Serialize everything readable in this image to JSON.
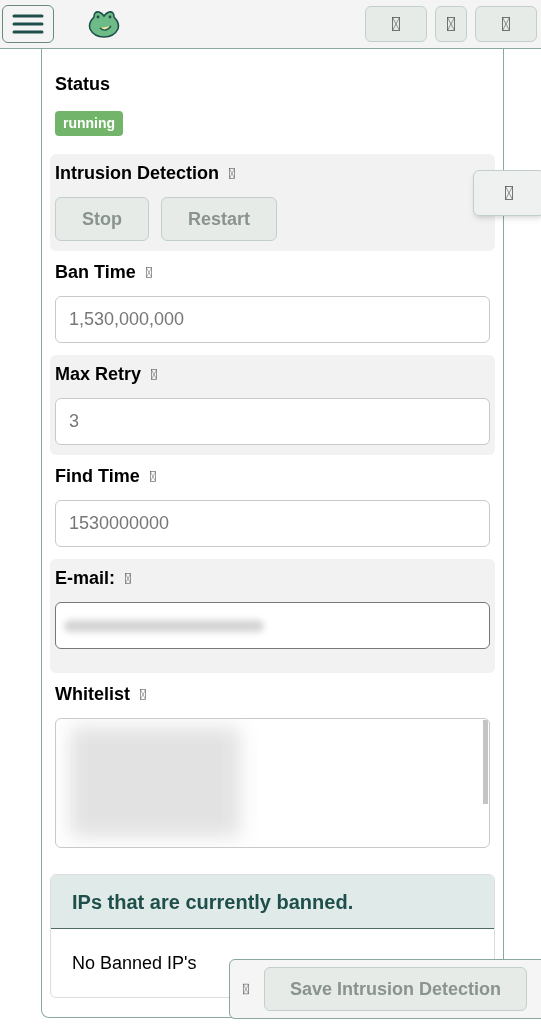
{
  "header": {
    "toolbar_buttons": [
      {
        "kind": "wide"
      },
      {
        "kind": "narrow"
      },
      {
        "kind": "wide"
      }
    ]
  },
  "status": {
    "label": "Status",
    "badge": "running"
  },
  "sections": [
    {
      "kind": "buttons",
      "label": "Intrusion Detection",
      "shaded": true,
      "buttons": [
        {
          "label": "Stop",
          "disabled": true
        },
        {
          "label": "Restart",
          "disabled": true
        }
      ]
    },
    {
      "kind": "input",
      "label": "Ban Time",
      "shaded": false,
      "placeholder": "1,530,000,000"
    },
    {
      "kind": "input",
      "label": "Max Retry",
      "shaded": true,
      "placeholder": "3"
    },
    {
      "kind": "input",
      "label": "Find Time",
      "shaded": false,
      "placeholder": "1530000000"
    },
    {
      "kind": "blurred-input",
      "label": "E-mail:",
      "shaded": true
    },
    {
      "kind": "textarea",
      "label": "Whitelist",
      "shaded": false
    }
  ],
  "banned_panel": {
    "title": "IPs that are currently banned.",
    "empty_text": "No Banned IP's"
  },
  "save_bar": {
    "button": "Save Intrusion Detection",
    "disabled": true
  }
}
